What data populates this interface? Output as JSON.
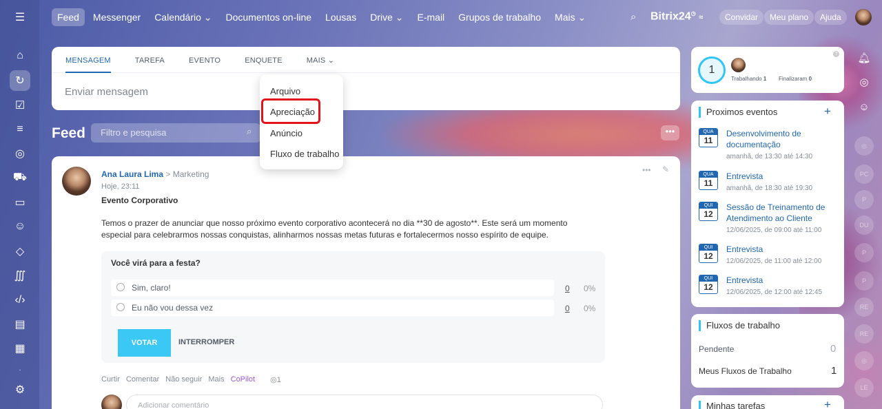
{
  "nav": {
    "items": [
      "Feed",
      "Messenger",
      "Calendário ⌄",
      "Documentos on-line",
      "Lousas",
      "Drive ⌄",
      "E-mail",
      "Grupos de trabalho",
      "Mais ⌄"
    ],
    "brand": "Bitrix24",
    "invite": "Convidar",
    "plan": "Meu plano",
    "help": "Ajuda"
  },
  "composer": {
    "tabs": [
      "MENSAGEM",
      "TAREFA",
      "EVENTO",
      "ENQUETE",
      "MAIS ⌄"
    ],
    "placeholder": "Enviar mensagem"
  },
  "menu": {
    "items": [
      "Arquivo",
      "Apreciação",
      "Anúncio",
      "Fluxo de trabalho"
    ]
  },
  "feed": {
    "title": "Feed",
    "filter_placeholder": "Filtro e pesquisa",
    "more": "•••"
  },
  "post": {
    "author": "Ana Laura Lima",
    "arrow": ">",
    "group": "Marketing",
    "time": "Hoje, 23:11",
    "title": "Evento Corporativo",
    "body1": "Temos o prazer de anunciar que nosso próximo evento corporativo acontecerá no dia **30 de agosto**. Este será um momento",
    "body2": "especial para celebrarmos nossas conquistas, alinharmos nossas metas futuras e fortalecermos nosso espírito de equipe.",
    "poll": {
      "question": "Você virá para a festa?",
      "options": [
        {
          "label": "Sim, claro!",
          "count": "0",
          "pct": "0%"
        },
        {
          "label": "Eu não vou dessa vez",
          "count": "0",
          "pct": "0%"
        }
      ],
      "vote": "VOTAR",
      "stop": "INTERROMPER"
    },
    "actions": [
      "Curtir",
      "Comentar",
      "Não seguir",
      "Mais",
      "CoPilot"
    ],
    "views": "◎1",
    "comment_placeholder": "Adicionar comentário"
  },
  "status": {
    "count": "1",
    "working": "Trabalhando",
    "working_n": "1",
    "done": "Finalizaram",
    "done_n": "0"
  },
  "events": {
    "title": "Proximos eventos",
    "list": [
      {
        "dow": "QUA",
        "day": "11",
        "title": "Desenvolvimento de documentação",
        "time": "amanhã, de 13:30 até 14:30"
      },
      {
        "dow": "QUA",
        "day": "11",
        "title": "Entrevista",
        "time": "amanhã, de 18:30 até 19:30"
      },
      {
        "dow": "QUI",
        "day": "12",
        "title": "Sessão de Treinamento de Atendimento ao Cliente",
        "time": "12/06/2025, de 09:00 até 11:00"
      },
      {
        "dow": "QUI",
        "day": "12",
        "title": "Entrevista",
        "time": "12/06/2025, de 11:00 até 12:00"
      },
      {
        "dow": "QUI",
        "day": "12",
        "title": "Entrevista",
        "time": "12/06/2025, de 12:00 até 12:45"
      }
    ]
  },
  "workflows": {
    "title": "Fluxos de trabalho",
    "pending": "Pendente",
    "pending_n": "0",
    "mine": "Meus Fluxos de Trabalho",
    "mine_n": "1"
  },
  "tasks": {
    "title": "Minhas tarefas"
  },
  "rrail": [
    "PC",
    "P",
    "DU",
    "P",
    "P",
    "RE",
    "RE",
    "LE"
  ]
}
